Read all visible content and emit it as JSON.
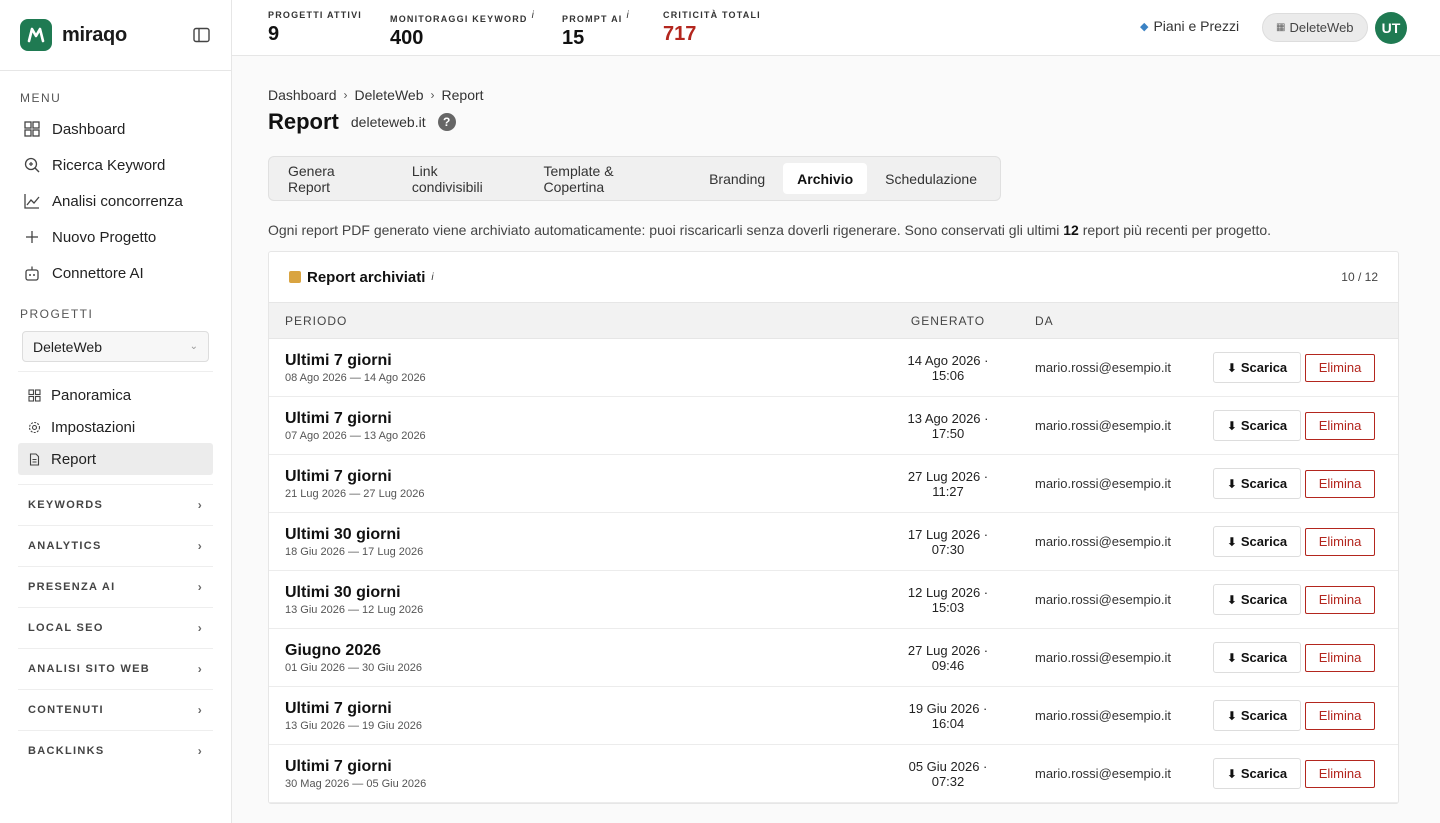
{
  "app": {
    "name": "miraqo",
    "brand_color": "#1f7a52",
    "danger_color": "#b3261e"
  },
  "sidebar": {
    "menu_title": "MENU",
    "menu": [
      {
        "label": "Dashboard",
        "icon": "grid-icon"
      },
      {
        "label": "Ricerca Keyword",
        "icon": "search-icon"
      },
      {
        "label": "Analisi concorrenza",
        "icon": "chart-line-icon"
      },
      {
        "label": "Nuovo Progetto",
        "icon": "plus-icon"
      },
      {
        "label": "Connettore AI",
        "icon": "robot-icon"
      }
    ],
    "projects_title": "PROGETTI",
    "project_selected": "DeleteWeb",
    "sub": [
      {
        "label": "Panoramica",
        "icon": "grid-icon"
      },
      {
        "label": "Impostazioni",
        "icon": "gear-icon"
      },
      {
        "label": "Report",
        "icon": "document-icon"
      }
    ],
    "groups": [
      "KEYWORDS",
      "ANALYTICS",
      "PRESENZA AI",
      "LOCAL SEO",
      "ANALISI SITO WEB",
      "CONTENUTI",
      "BACKLINKS"
    ]
  },
  "topbar": {
    "stats": [
      {
        "label": "PROGETTI ATTIVI",
        "value": "9",
        "info": ""
      },
      {
        "label": "MONITORAGGI KEYWORD",
        "value": "400",
        "info": "i"
      },
      {
        "label": "PROMPT AI",
        "value": "15",
        "info": "i"
      },
      {
        "label": "CRITICITÀ TOTALI",
        "value": "717",
        "info": ""
      }
    ],
    "pricing": "Piani e Prezzi",
    "project_pill": "DeleteWeb",
    "avatar": "UT"
  },
  "breadcrumb": [
    "Dashboard",
    "DeleteWeb",
    "Report"
  ],
  "page": {
    "title": "Report",
    "domain": "deleteweb.it",
    "help": "?"
  },
  "tabs": [
    "Genera Report",
    "Link condivisibili",
    "Template & Copertina",
    "Branding",
    "Archivio",
    "Schedulazione"
  ],
  "active_tab": "Archivio",
  "intro": {
    "before": "Ogni report PDF generato viene archiviato automaticamente: puoi riscaricarli senza doverli rigenerare. Sono conservati gli ultimi ",
    "bold": "12",
    "after": " report più recenti per progetto."
  },
  "archive": {
    "title": "Report archiviati",
    "info": "i",
    "count": "10 / 12",
    "columns": [
      "PERIODO",
      "GENERATO",
      "DA"
    ],
    "download_label": "Scarica",
    "delete_label": "Elimina",
    "rows": [
      {
        "label": "Ultimi 7 giorni",
        "range": "08 Ago 2026 — 14 Ago 2026",
        "gen1": "14 Ago 2026 ·",
        "gen2": "15:06",
        "by": "mario.rossi@esempio.it"
      },
      {
        "label": "Ultimi 7 giorni",
        "range": "07 Ago 2026 — 13 Ago 2026",
        "gen1": "13 Ago 2026 ·",
        "gen2": "17:50",
        "by": "mario.rossi@esempio.it"
      },
      {
        "label": "Ultimi 7 giorni",
        "range": "21 Lug 2026 — 27 Lug 2026",
        "gen1": "27 Lug 2026 ·",
        "gen2": "11:27",
        "by": "mario.rossi@esempio.it"
      },
      {
        "label": "Ultimi 30 giorni",
        "range": "18 Giu 2026 — 17 Lug 2026",
        "gen1": "17 Lug 2026 ·",
        "gen2": "07:30",
        "by": "mario.rossi@esempio.it"
      },
      {
        "label": "Ultimi 30 giorni",
        "range": "13 Giu 2026 — 12 Lug 2026",
        "gen1": "12 Lug 2026 ·",
        "gen2": "15:03",
        "by": "mario.rossi@esempio.it"
      },
      {
        "label": "Giugno 2026",
        "range": "01 Giu 2026 — 30 Giu 2026",
        "gen1": "27 Lug 2026 ·",
        "gen2": "09:46",
        "by": "mario.rossi@esempio.it"
      },
      {
        "label": "Ultimi 7 giorni",
        "range": "13 Giu 2026 — 19 Giu 2026",
        "gen1": "19 Giu 2026 ·",
        "gen2": "16:04",
        "by": "mario.rossi@esempio.it"
      },
      {
        "label": "Ultimi 7 giorni",
        "range": "30 Mag 2026 — 05 Giu 2026",
        "gen1": "05 Giu 2026 ·",
        "gen2": "07:32",
        "by": "mario.rossi@esempio.it"
      }
    ]
  }
}
